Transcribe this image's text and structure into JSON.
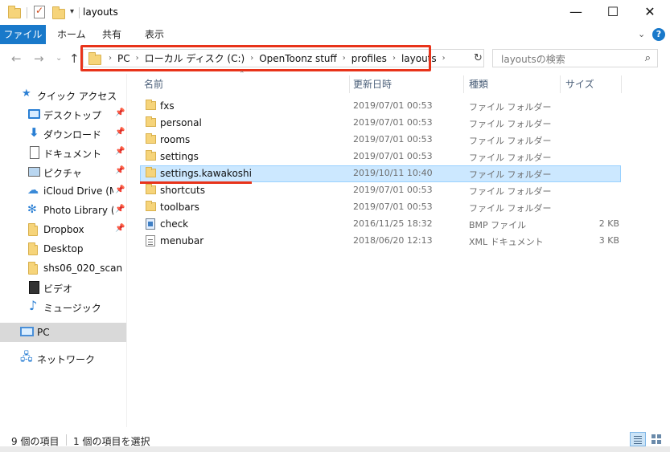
{
  "window": {
    "title": "layouts",
    "minimize": "—",
    "maximize": "☐",
    "close": "✕"
  },
  "ribbon": {
    "tabs": [
      "ファイル",
      "ホーム",
      "共有",
      "表示"
    ]
  },
  "address": {
    "crumbs": [
      "PC",
      "ローカル ディスク (C:)",
      "OpenToonz stuff",
      "profiles",
      "layouts"
    ]
  },
  "search": {
    "placeholder": "layoutsの検索"
  },
  "nav": {
    "quick_access": "クイック アクセス",
    "items": [
      {
        "label": "デスクトップ",
        "icon": "desktop-icon",
        "pinned": true
      },
      {
        "label": "ダウンロード",
        "icon": "download-icon",
        "pinned": true
      },
      {
        "label": "ドキュメント",
        "icon": "document-icon",
        "pinned": true
      },
      {
        "label": "ピクチャ",
        "icon": "picture-icon",
        "pinned": true
      },
      {
        "label": "iCloud Drive (Ma",
        "icon": "cloud-icon",
        "pinned": true
      },
      {
        "label": "Photo Library (M",
        "icon": "photo-library-icon",
        "pinned": true
      },
      {
        "label": "Dropbox",
        "icon": "folder-icon",
        "pinned": true
      },
      {
        "label": "Desktop",
        "icon": "folder-icon",
        "pinned": false
      },
      {
        "label": "shs06_020_scan",
        "icon": "folder-icon",
        "pinned": false
      },
      {
        "label": "ビデオ",
        "icon": "video-icon",
        "pinned": false
      },
      {
        "label": "ミュージック",
        "icon": "music-icon",
        "pinned": false
      }
    ],
    "pc": "PC",
    "network": "ネットワーク"
  },
  "columns": {
    "name": "名前",
    "date": "更新日時",
    "type": "種類",
    "size": "サイズ"
  },
  "files": [
    {
      "name": "fxs",
      "date": "2019/07/01 00:53",
      "type": "ファイル フォルダー",
      "size": "",
      "icon": "folder-icon",
      "selected": false
    },
    {
      "name": "personal",
      "date": "2019/07/01 00:53",
      "type": "ファイル フォルダー",
      "size": "",
      "icon": "folder-icon",
      "selected": false
    },
    {
      "name": "rooms",
      "date": "2019/07/01 00:53",
      "type": "ファイル フォルダー",
      "size": "",
      "icon": "folder-icon",
      "selected": false
    },
    {
      "name": "settings",
      "date": "2019/07/01 00:53",
      "type": "ファイル フォルダー",
      "size": "",
      "icon": "folder-icon",
      "selected": false
    },
    {
      "name": "settings.kawakoshi",
      "date": "2019/10/11 10:40",
      "type": "ファイル フォルダー",
      "size": "",
      "icon": "folder-icon",
      "selected": true
    },
    {
      "name": "shortcuts",
      "date": "2019/07/01 00:53",
      "type": "ファイル フォルダー",
      "size": "",
      "icon": "folder-icon",
      "selected": false
    },
    {
      "name": "toolbars",
      "date": "2019/07/01 00:53",
      "type": "ファイル フォルダー",
      "size": "",
      "icon": "folder-icon",
      "selected": false
    },
    {
      "name": "check",
      "date": "2016/11/25 18:32",
      "type": "BMP ファイル",
      "size": "2 KB",
      "icon": "bmp-file-icon",
      "selected": false
    },
    {
      "name": "menubar",
      "date": "2018/06/20 12:13",
      "type": "XML ドキュメント",
      "size": "3 KB",
      "icon": "xml-file-icon",
      "selected": false
    }
  ],
  "status": {
    "item_count": "9 個の項目",
    "selected_count": "1 個の項目を選択"
  },
  "colors": {
    "accent": "#1979ca",
    "highlight": "#e8331a",
    "selection": "#cce8ff"
  }
}
